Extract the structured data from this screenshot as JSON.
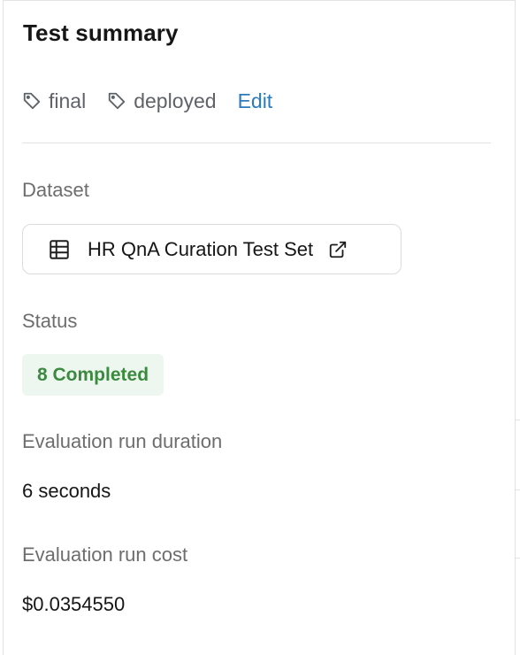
{
  "panel": {
    "title": "Test summary"
  },
  "tags": [
    {
      "label": "final",
      "icon": "tag-icon"
    },
    {
      "label": "deployed",
      "icon": "tag-icon"
    }
  ],
  "tags_edit_label": "Edit",
  "dataset": {
    "label": "Dataset",
    "name": "HR QnA Curation Test Set",
    "icon": "table-icon",
    "link_icon": "external-link-icon"
  },
  "status": {
    "label": "Status",
    "badge": "8 Completed",
    "badge_color": "#3b8a3f",
    "badge_background": "#eef7ef"
  },
  "duration": {
    "label": "Evaluation run duration",
    "value": "6 seconds"
  },
  "cost": {
    "label": "Evaluation run cost",
    "value": "$0.0354550"
  },
  "colors": {
    "link": "#2a7bc0",
    "muted_text": "#6d6d6d",
    "border": "#dcdcdc"
  }
}
